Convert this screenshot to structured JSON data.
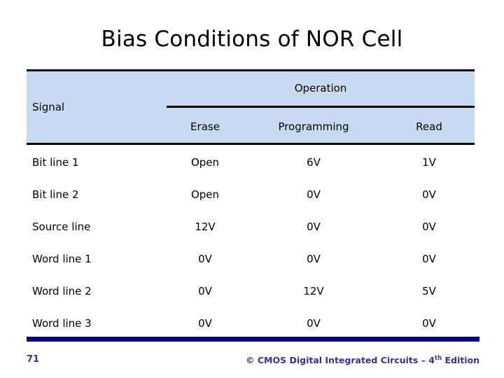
{
  "slide": {
    "title": "Bias Conditions of NOR Cell",
    "page_number": "71",
    "background_color": "#ffffff",
    "title_color": "#000000",
    "accent_color": "#000080",
    "header_band_color": "#c7daf1",
    "footer_text_color": "#333399"
  },
  "table": {
    "signal_header": "Signal",
    "group_header": "Operation",
    "columns": [
      "Erase",
      "Programming",
      "Read"
    ],
    "rows": [
      {
        "label": "Bit line 1",
        "erase": "Open",
        "programming": "6V",
        "read": "1V"
      },
      {
        "label": "Bit line 2",
        "erase": "Open",
        "programming": "0V",
        "read": "0V"
      },
      {
        "label": "Source line",
        "erase": "12V",
        "programming": "0V",
        "read": "0V"
      },
      {
        "label": "Word line 1",
        "erase": "0V",
        "programming": "0V",
        "read": "0V"
      },
      {
        "label": "Word line 2",
        "erase": "0V",
        "programming": "12V",
        "read": "5V"
      },
      {
        "label": "Word line 3",
        "erase": "0V",
        "programming": "0V",
        "read": "0V"
      }
    ]
  },
  "footer": {
    "page": "71",
    "credit_prefix": "© CMOS Digital Integrated Circuits – 4",
    "credit_sup": "th",
    "credit_suffix": " Edition"
  }
}
